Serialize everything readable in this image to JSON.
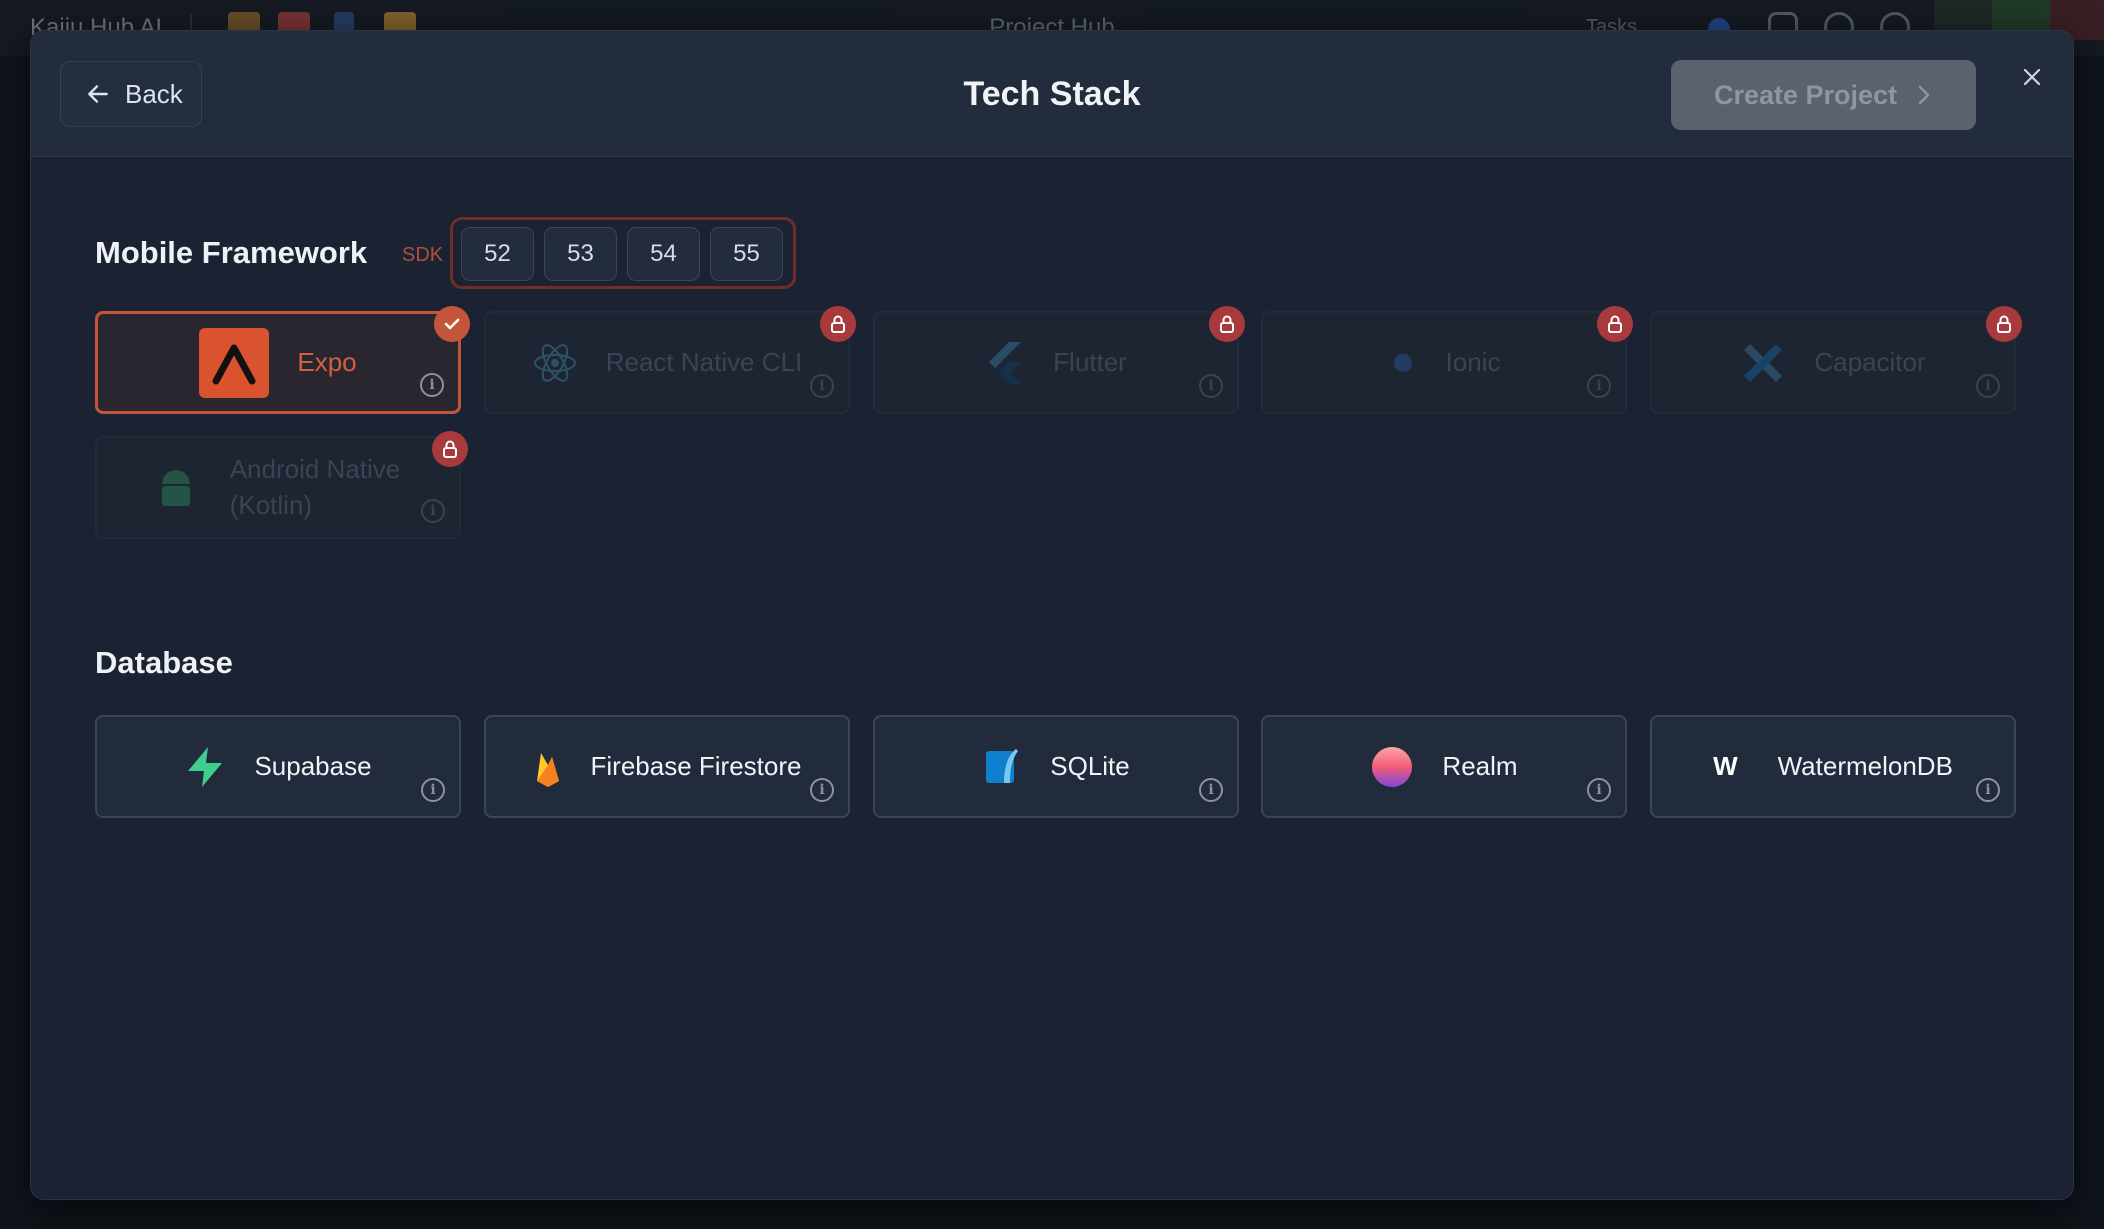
{
  "background_app": {
    "name": "Kaiju Hub AI",
    "window_title": "Project Hub",
    "tasks_label": "Tasks"
  },
  "header": {
    "back_label": "Back",
    "title": "Tech Stack",
    "create_label": "Create Project"
  },
  "mobile": {
    "title": "Mobile Framework",
    "sdk_label": "SDK",
    "sdk_versions": [
      "52",
      "53",
      "54",
      "55"
    ],
    "frameworks": [
      {
        "name": "Expo",
        "icon": "expo-icon",
        "state": "selected"
      },
      {
        "name": "React Native CLI",
        "icon": "react-icon",
        "state": "locked"
      },
      {
        "name": "Flutter",
        "icon": "flutter-icon",
        "state": "locked"
      },
      {
        "name": "Ionic",
        "icon": "ionic-icon",
        "state": "locked"
      },
      {
        "name": "Capacitor",
        "icon": "capacitor-icon",
        "state": "locked"
      },
      {
        "name_line1": "Android Native",
        "name_line2": "(Kotlin)",
        "icon": "android-icon",
        "state": "locked"
      }
    ]
  },
  "database": {
    "title": "Database",
    "options": [
      {
        "name": "Supabase",
        "icon": "supabase-icon"
      },
      {
        "name": "Firebase Firestore",
        "icon": "firebase-icon"
      },
      {
        "name": "SQLite",
        "icon": "sqlite-icon"
      },
      {
        "name": "Realm",
        "icon": "realm-icon"
      },
      {
        "name": "WatermelonDB",
        "icon": "watermelondb-icon",
        "logo_letter": "W"
      }
    ]
  },
  "colors": {
    "accent": "#c2553a",
    "lock_badge": "#a83a3e",
    "modal_bg": "#1b2332"
  }
}
